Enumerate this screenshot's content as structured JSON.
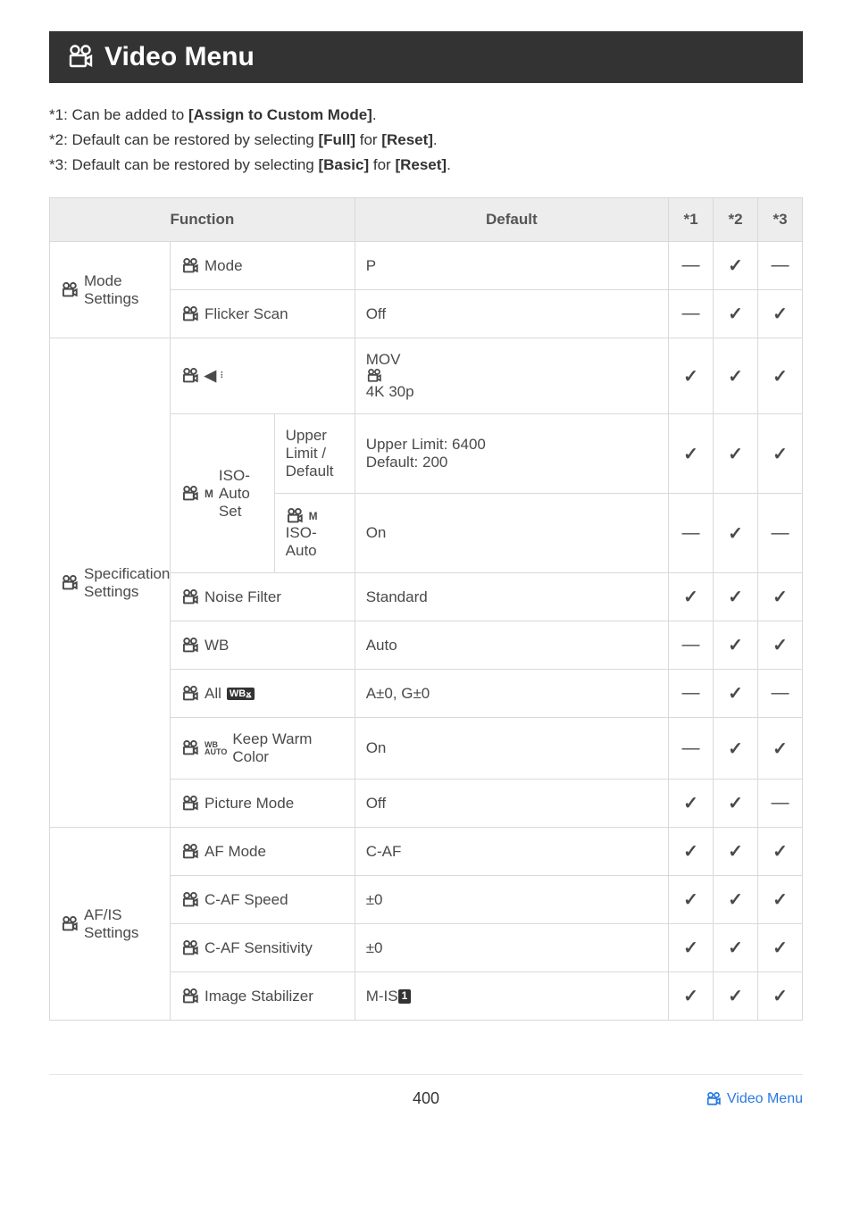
{
  "title": "Video Menu",
  "notes": {
    "n1_pre": "*1: Can be added to ",
    "n1_bold": "[Assign to Custom Mode]",
    "n1_post": ".",
    "n2_pre": "*2: Default can be restored by selecting ",
    "n2_b1": "[Full]",
    "n2_mid": " for ",
    "n2_b2": "[Reset]",
    "n2_post": ".",
    "n3_pre": "*3: Default can be restored by selecting ",
    "n3_b1": "[Basic]",
    "n3_mid": " for ",
    "n3_b2": "[Reset]",
    "n3_post": "."
  },
  "headers": {
    "function": "Function",
    "default": "Default",
    "c1": "*1",
    "c2": "*2",
    "c3": "*3"
  },
  "groups": {
    "mode_settings": " Mode Settings",
    "spec_settings": " Specification Settings",
    "afis_settings": " AF/IS Settings"
  },
  "rows": {
    "mode": {
      "label": " Mode",
      "default": "P",
      "m1": "—",
      "m2": "✓",
      "m3": "—"
    },
    "flicker": {
      "label": " Flicker Scan",
      "default": "Off",
      "m1": "—",
      "m2": "✓",
      "m3": "✓"
    },
    "quality": {
      "default_pre": "MOV ",
      "default_post": " 4K 30p",
      "m1": "✓",
      "m2": "✓",
      "m3": "✓"
    },
    "iso_group_label": "ISO-Auto Set",
    "iso_upper": {
      "sub": "Upper Limit / Default",
      "default": "Upper Limit: 6400\nDefault: 200",
      "m1": "✓",
      "m2": "✓",
      "m3": "✓"
    },
    "iso_auto": {
      "sub": " ISO-Auto",
      "default": "On",
      "m1": "—",
      "m2": "✓",
      "m3": "—"
    },
    "noise": {
      "label": " Noise Filter",
      "default": "Standard",
      "m1": "✓",
      "m2": "✓",
      "m3": "✓"
    },
    "wb": {
      "label": " WB",
      "default": "Auto",
      "m1": "—",
      "m2": "✓",
      "m3": "✓"
    },
    "allwb": {
      "label_pre": " All ",
      "default": "A±0, G±0",
      "m1": "—",
      "m2": "✓",
      "m3": "—"
    },
    "keepwarm": {
      "label_post": " Keep Warm Color",
      "default": "On",
      "m1": "—",
      "m2": "✓",
      "m3": "✓"
    },
    "picmode": {
      "label": " Picture Mode",
      "default": "Off",
      "m1": "✓",
      "m2": "✓",
      "m3": "—"
    },
    "afmode": {
      "label": " AF Mode",
      "default": "C-AF",
      "m1": "✓",
      "m2": "✓",
      "m3": "✓"
    },
    "cafspeed": {
      "label": " C-AF Speed",
      "default": "±0",
      "m1": "✓",
      "m2": "✓",
      "m3": "✓"
    },
    "cafsens": {
      "label": " C-AF Sensitivity",
      "default": "±0",
      "m1": "✓",
      "m2": "✓",
      "m3": "✓"
    },
    "imgstab": {
      "label": " Image Stabilizer",
      "default_pre": "M-IS",
      "default_box": "1",
      "m1": "✓",
      "m2": "✓",
      "m3": "✓"
    }
  },
  "footer": {
    "page": "400",
    "link": " Video Menu"
  }
}
